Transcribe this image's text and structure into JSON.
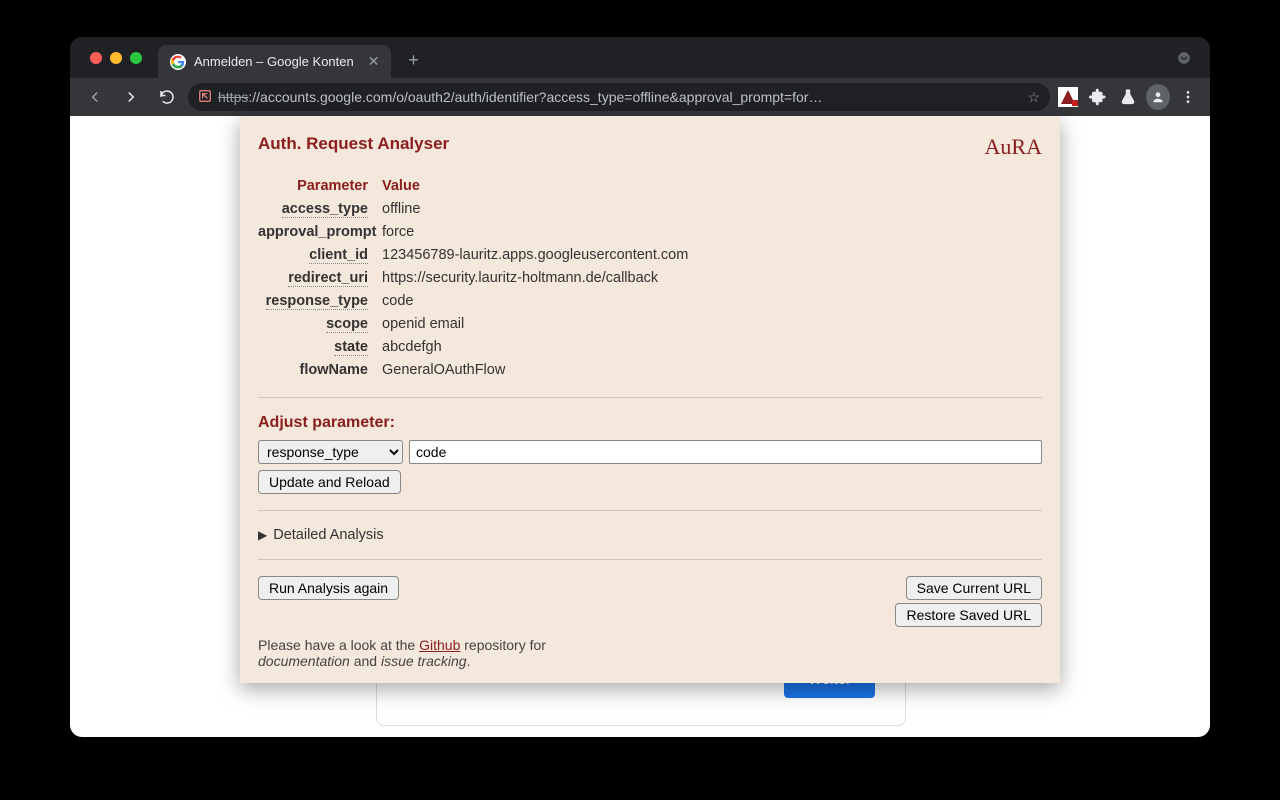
{
  "browser": {
    "tab_title": "Anmelden – Google Konten",
    "url_https": "https",
    "url_rest": "://accounts.google.com/o/oauth2/auth/identifier?access_type=offline&approval_prompt=for…"
  },
  "google": {
    "weiter": "Weiter"
  },
  "popup": {
    "title": "Auth. Request Analyser",
    "logo": "AuRA",
    "header_param": "Parameter",
    "header_value": "Value",
    "params": [
      {
        "name": "access_type",
        "value": "offline",
        "dotted": true
      },
      {
        "name": "approval_prompt",
        "value": "force",
        "dotted": false
      },
      {
        "name": "client_id",
        "value": "123456789-lauritz.apps.googleusercontent.com",
        "dotted": true
      },
      {
        "name": "redirect_uri",
        "value": "https://security.lauritz-holtmann.de/callback",
        "dotted": true
      },
      {
        "name": "response_type",
        "value": "code",
        "dotted": true
      },
      {
        "name": "scope",
        "value": "openid email",
        "dotted": true
      },
      {
        "name": "state",
        "value": "abcdefgh",
        "dotted": true
      },
      {
        "name": "flowName",
        "value": "GeneralOAuthFlow",
        "dotted": false
      }
    ],
    "adjust_title": "Adjust parameter:",
    "select_value": "response_type",
    "input_value": "code",
    "update_label": "Update and Reload",
    "details_label": "Detailed Analysis",
    "run_label": "Run Analysis again",
    "save_label": "Save Current URL",
    "restore_label": "Restore Saved URL",
    "footer_pre": "Please have a look at the ",
    "footer_link": "Github",
    "footer_mid": " repository for ",
    "footer_doc": "documentation",
    "footer_and": " and ",
    "footer_issue": "issue tracking",
    "footer_end": "."
  }
}
